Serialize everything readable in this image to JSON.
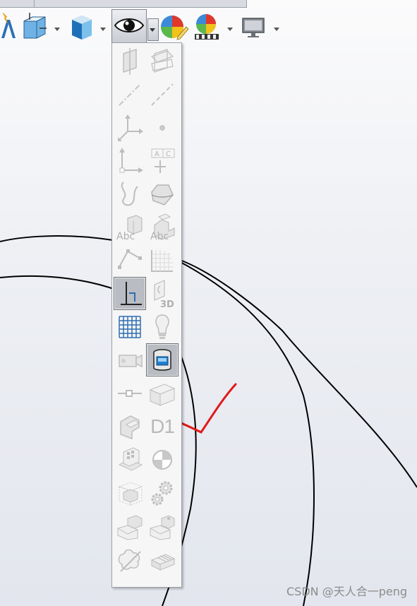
{
  "toolbar": {
    "items": [
      {
        "name": "sketch-text-icon"
      },
      {
        "name": "view-orientation-icon"
      },
      {
        "name": "display-style-icon"
      },
      {
        "name": "hide-show-items-icon"
      },
      {
        "name": "edit-appearance-icon"
      },
      {
        "name": "apply-scene-icon"
      },
      {
        "name": "view-settings-icon"
      }
    ]
  },
  "flyout": {
    "items": [
      "view-planes-icon",
      "view-all-planes-icon",
      "view-axes-icon",
      "view-temporary-axes-icon",
      "view-origins-icon",
      "view-points-icon",
      "view-coordinate-systems-icon",
      "view-annotation-icon",
      "view-curves-icon",
      "view-parting-lines-icon",
      "view-sketches-abc-icon",
      "view-3d-sketch-abc-icon",
      "view-sketch-relations-icon",
      "view-grid-icon",
      "view-sketch-dimensions-icon",
      "view-3d-sketch-planes-icon",
      "view-sketch-grid-icon",
      "view-lights-icon",
      "view-cameras-icon",
      "view-decals-icon",
      "view-routing-points-icon",
      "view-weld-beads-icon",
      "view-feature-dimensions-icon",
      "view-dimension-names-icon",
      "view-sensors-icon",
      "view-center-of-mass-icon",
      "view-bounding-box-icon",
      "view-gears-icon",
      "view-mates-icon",
      "view-mate-references-icon",
      "view-sketch-picture-icon",
      "view-cosmetic-threads-icon"
    ],
    "labels": {
      "sketch_abc": "Abc",
      "sketch3d_abc": "Abc",
      "annotation_a": "A",
      "annotation_c": "C",
      "plane_3d": "3D",
      "dimension_names": "D1"
    },
    "active": [
      "view-sketch-dimensions-icon",
      "view-decals-icon"
    ]
  },
  "watermark": "CSDN @天人合一peng"
}
